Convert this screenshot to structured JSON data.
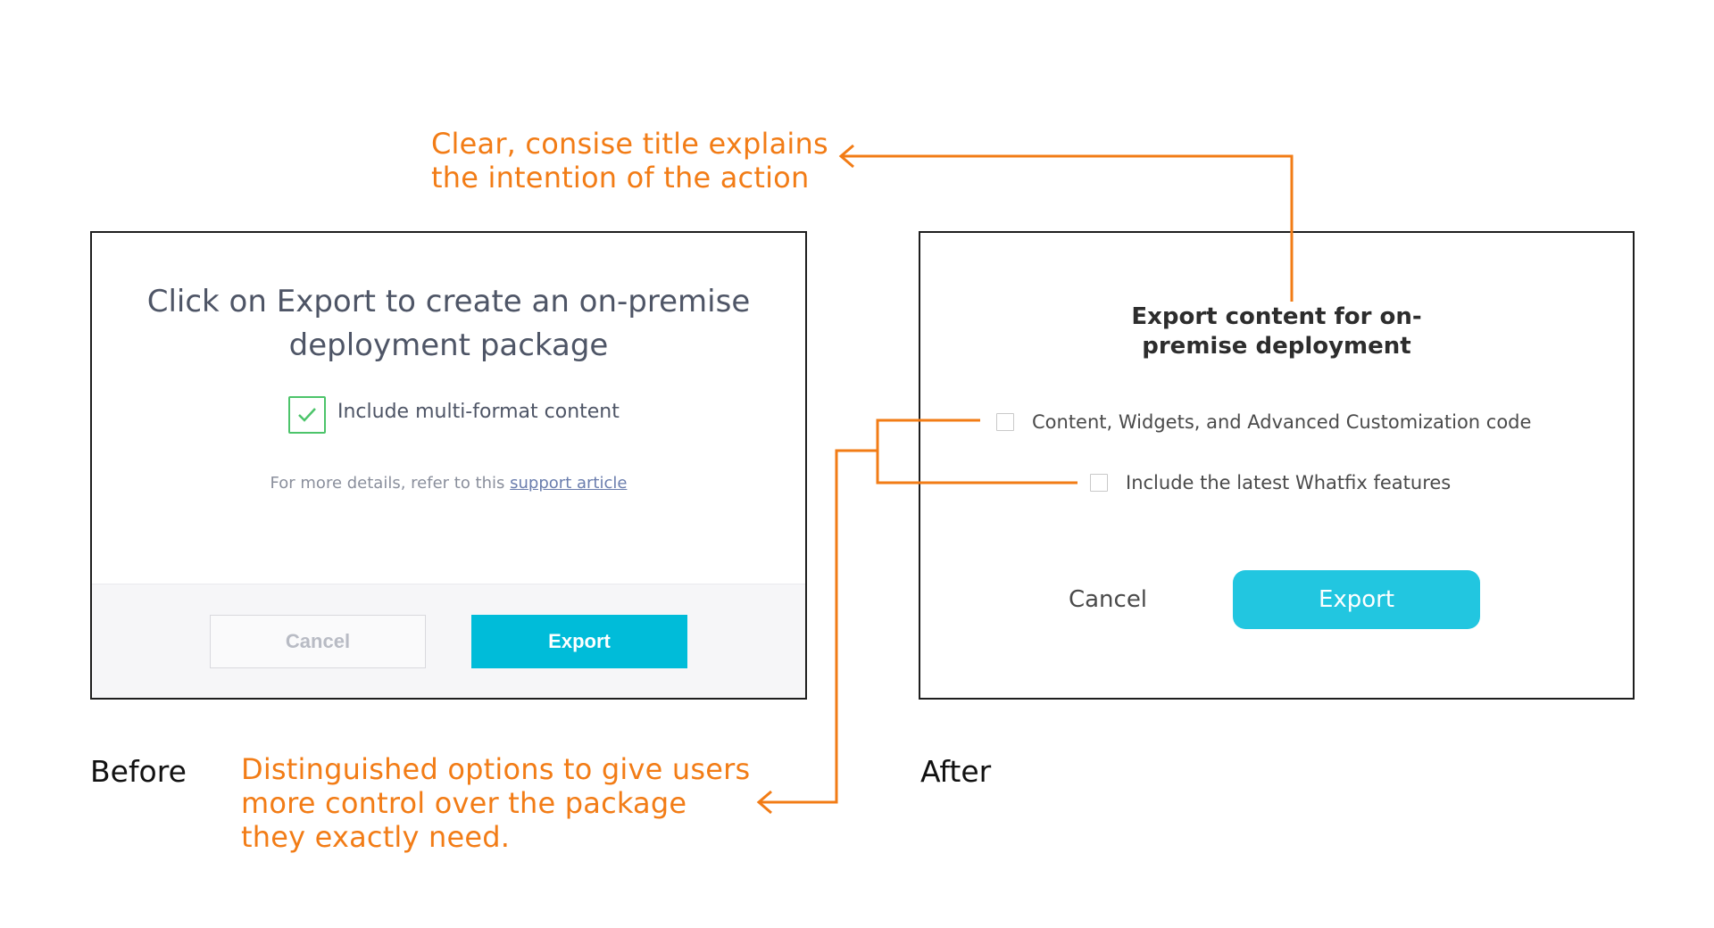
{
  "annotations": {
    "title_note": "Clear, consise title explains the intention of the action",
    "options_note": "Distinguished options to give users more control over the package they exactly need."
  },
  "captions": {
    "before": "Before",
    "after": "After"
  },
  "before": {
    "title": "Click on Export to create an on-premise deployment package",
    "checkbox_label": "Include multi-format content",
    "checkbox_checked": true,
    "details_text": "For more details, refer to this",
    "details_link": "support article",
    "cancel_label": "Cancel",
    "export_label": "Export"
  },
  "after": {
    "title": "Export content for on-premise deployment",
    "options": [
      {
        "label": "Content, Widgets, and Advanced Customization code",
        "checked": false
      },
      {
        "label": "Include the latest Whatfix features",
        "checked": false
      }
    ],
    "cancel_label": "Cancel",
    "export_label": "Export"
  },
  "colors": {
    "annotation": "#f27c16",
    "before_accent": "#00bcd9",
    "after_accent": "#22c6e0",
    "check_green": "#4cc46a"
  },
  "icons": [
    "checkmark-icon",
    "arrow-left-icon"
  ]
}
